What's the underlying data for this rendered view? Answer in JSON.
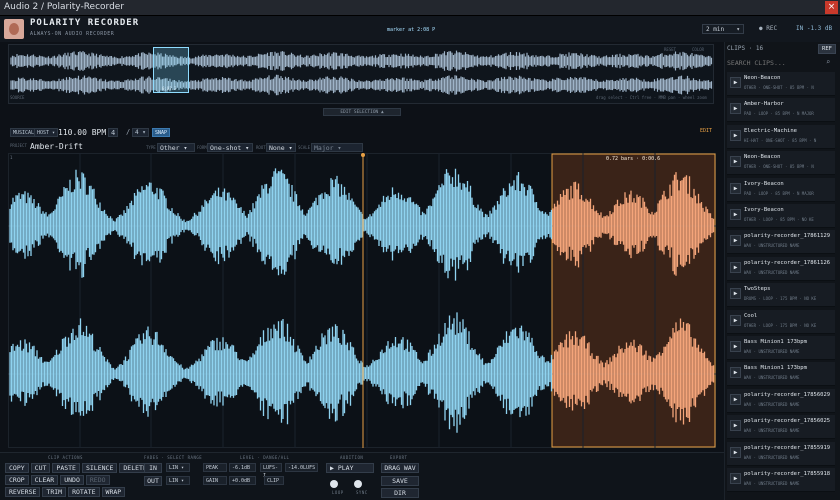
{
  "window": {
    "title": "Audio 2 / Polarity-Recorder",
    "close_label": "×"
  },
  "header": {
    "app_name": "POLARITY RECORDER",
    "subtitle": "ALWAYS-ON AUDIO RECORDER",
    "marker": "marker at 2:08 P",
    "duration": "2 min",
    "duration_chevron": "▾",
    "rec_label": "● REC",
    "input_level": "IN -1.3 dB"
  },
  "overview": {
    "selection_time": "0:02.3",
    "reset_label": "RESET",
    "color_label": "COLOR",
    "source_label": "SOURCE",
    "hint": "drag select · Ctrl free · MMB pan · wheel zoom",
    "edit_selection": "EDIT SELECTION ▲"
  },
  "toolbar": {
    "musical_label": "MUSICAL",
    "host_label": "HOST ▾",
    "bpm": "110.00 BPM",
    "sig_num": "4",
    "sig_sep": "/",
    "sig_den": "4 ▾",
    "snap_label": "SNAP",
    "edit_label": "EDIT"
  },
  "meta": {
    "project_label": "PROJECT",
    "project_name": "Amber-Drift",
    "type_label": "TYPE",
    "type_value": "Other ▾",
    "form_label": "FORM",
    "form_value": "One-shot ▾",
    "root_label": "ROOT",
    "root_value": "None ▾",
    "scale_label": "SCALE",
    "scale_value": "Major ▾"
  },
  "editor": {
    "ruler_start": "1",
    "selection_label": "0.72 bars · 0:00.6"
  },
  "bottom": {
    "clip_actions_label": "CLIP ACTIONS",
    "actions_row1": [
      "COPY",
      "CUT",
      "PASTE",
      "SILENCE",
      "DELETE"
    ],
    "actions_row2": [
      "CROP",
      "CLEAR",
      "UNDO",
      "REDO"
    ],
    "actions_row3": [
      "REVERSE",
      "TRIM",
      "ROTATE",
      "WRAP"
    ],
    "fades_label": "FADES · SELECT RANGE",
    "fade_in": "IN",
    "fade_in_curve": "LIN ▾",
    "fade_out": "OUT",
    "fade_out_curve": "LIN ▾",
    "level_label": "LEVEL · DANGE/ALL",
    "peak_label": "PEAK",
    "peak_value": "-6.1dB",
    "lufs_mode": "LUFS-I",
    "lufs_value": "-14.0LUFS",
    "gain_label": "GAIN",
    "gain_value": "+0.0dB",
    "clip_label": "CLIP",
    "audition_label": "AUDITION",
    "play_label": "▶ PLAY",
    "loop_label": "LOOP",
    "sync_label": "SYNC",
    "export_label": "EXPORT",
    "drag_wav": "DRAG WAV",
    "save": "SAVE",
    "dir": "DIR"
  },
  "sidebar": {
    "title": "CLIPS · 16",
    "refresh": "REF",
    "search_placeholder": "SEARCH CLIPS...",
    "clips": [
      {
        "name": "Neon-Beacon",
        "meta": "OTHER · ONE-SHOT · 85 BPM · N"
      },
      {
        "name": "Amber-Harbor",
        "meta": "PAD · LOOP · 85 BPM · N MAJOR"
      },
      {
        "name": "Electric-Machine",
        "meta": "HI-HAT · ONE-SHOT · 85 BPM · N"
      },
      {
        "name": "Neon-Beacon",
        "meta": "OTHER · ONE-SHOT · 85 BPM · N"
      },
      {
        "name": "Ivory-Beacon",
        "meta": "PAD · LOOP · 85 BPM · N MAJOR"
      },
      {
        "name": "Ivory-Beacon",
        "meta": "OTHER · LOOP · 85 BPM · NO KE"
      },
      {
        "name": "polarity-recorder_17861129",
        "meta": "WAV · UNSTRUCTURED NAME"
      },
      {
        "name": "polarity-recorder_17861126",
        "meta": "WAV · UNSTRUCTURED NAME"
      },
      {
        "name": "TwoSteps",
        "meta": "DRUMS · LOOP · 175 BPM · NO KE"
      },
      {
        "name": "Cool",
        "meta": "OTHER · LOOP · 175 BPM · NO KE"
      },
      {
        "name": "Bass Minion1 173bpm",
        "meta": "WAV · UNSTRUCTURED NAME"
      },
      {
        "name": "Bass Minion1 173bpm",
        "meta": "WAV · UNSTRUCTURED NAME"
      },
      {
        "name": "polarity-recorder_17856029",
        "meta": "WAV · UNSTRUCTURED NAME"
      },
      {
        "name": "polarity-recorder_17856025",
        "meta": "WAV · UNSTRUCTURED NAME"
      },
      {
        "name": "polarity-recorder_17855919",
        "meta": "WAV · UNSTRUCTURED NAME"
      },
      {
        "name": "polarity-recorder_17855918",
        "meta": "WAV · UNSTRUCTURED NAME"
      }
    ]
  },
  "colors": {
    "wave": "#8fd3f0",
    "selection_wave": "#f4a57a",
    "selection_bg": "#3a2318",
    "accent": "#e8a044",
    "overview_wave": "#9fb4c8"
  }
}
